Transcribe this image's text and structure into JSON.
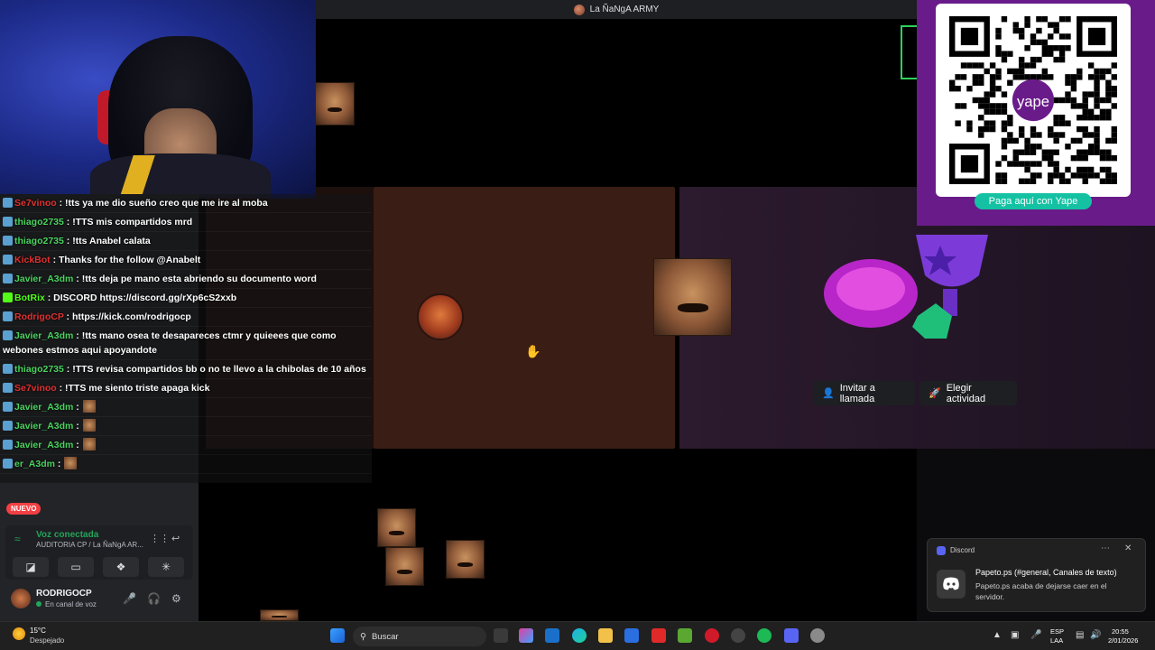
{
  "window": {
    "title": "La ÑaNgA ARMY"
  },
  "stream_overlay": {
    "chat": [
      {
        "user": "Se7vinoo",
        "user_color": "#e03030",
        "message": ": !tts ya me dio sueño creo que me ire al moba"
      },
      {
        "user": "thiago2735",
        "user_color": "#4ad25f",
        "message": ": !TTS mis compartidos mrd"
      },
      {
        "user": "thiago2735",
        "user_color": "#4ad25f",
        "message": ": !tts Anabel calata"
      },
      {
        "user": "KickBot",
        "user_color": "#e03030",
        "message": ": Thanks for the follow @Anabelt"
      },
      {
        "user": "Javier_A3dm",
        "user_color": "#4ad25f",
        "message": ": !tts deja pe mano esta abriendo su documento word"
      },
      {
        "user": "BotRix",
        "user_color": "#53fc18",
        "message": ": DISCORD https://discord.gg/rXp6cS2xxb"
      },
      {
        "user": "RodrigoCP",
        "user_color": "#e03030",
        "message": ": https://kick.com/rodrigocp"
      },
      {
        "user": "Javier_A3dm",
        "user_color": "#4ad25f",
        "message": ": !tts mano osea te desapareces ctmr y quieees que como webones estmos aqui apoyandote"
      },
      {
        "user": "thiago2735",
        "user_color": "#4ad25f",
        "message": ": !TTS revisa compartidos bb o no te llevo a la chibolas de 10 años"
      },
      {
        "user": "Se7vinoo",
        "user_color": "#e03030",
        "message": ": !TTS me siento triste apaga kick"
      },
      {
        "user": "Javier_A3dm",
        "user_color": "#4ad25f",
        "message": ":"
      },
      {
        "user": "Javier_A3dm",
        "user_color": "#4ad25f",
        "message": ":"
      },
      {
        "user": "Javier_A3dm",
        "user_color": "#4ad25f",
        "message": ":"
      },
      {
        "user": "er_A3dm",
        "user_color": "#4ad25f",
        "message": ":"
      }
    ],
    "qr": {
      "caption": "Paga aquí con Yape",
      "brand": "yape"
    }
  },
  "call": {
    "invite_label": "Invitar a llamada",
    "activity_label": "Elegir actividad"
  },
  "sidebar": {
    "new_badge": "NUEVO",
    "voice": {
      "status": "Voz conectada",
      "channel": "AUDITORIA CP / La ÑaNgA AR..."
    },
    "user": {
      "name": "RODRIGOCP",
      "status": "En canal de voz"
    }
  },
  "notification": {
    "app": "Discord",
    "title": "Papeto.ps (#general, Canales de texto)",
    "body": "Papeto.ps acaba de dejarse caer en el servidor."
  },
  "taskbar": {
    "weather_temp": "15°C",
    "weather_desc": "Despejado",
    "search_placeholder": "Buscar",
    "lang_top": "ESP",
    "lang_bottom": "LAA",
    "time": "20:55",
    "date": "2/01/2026"
  },
  "colors": {
    "discord_bg": "#1e1f22",
    "yape_purple": "#6a1b8a",
    "yape_teal": "#14c2a3",
    "voice_green": "#23a55a",
    "badge_red": "#f23f43"
  }
}
